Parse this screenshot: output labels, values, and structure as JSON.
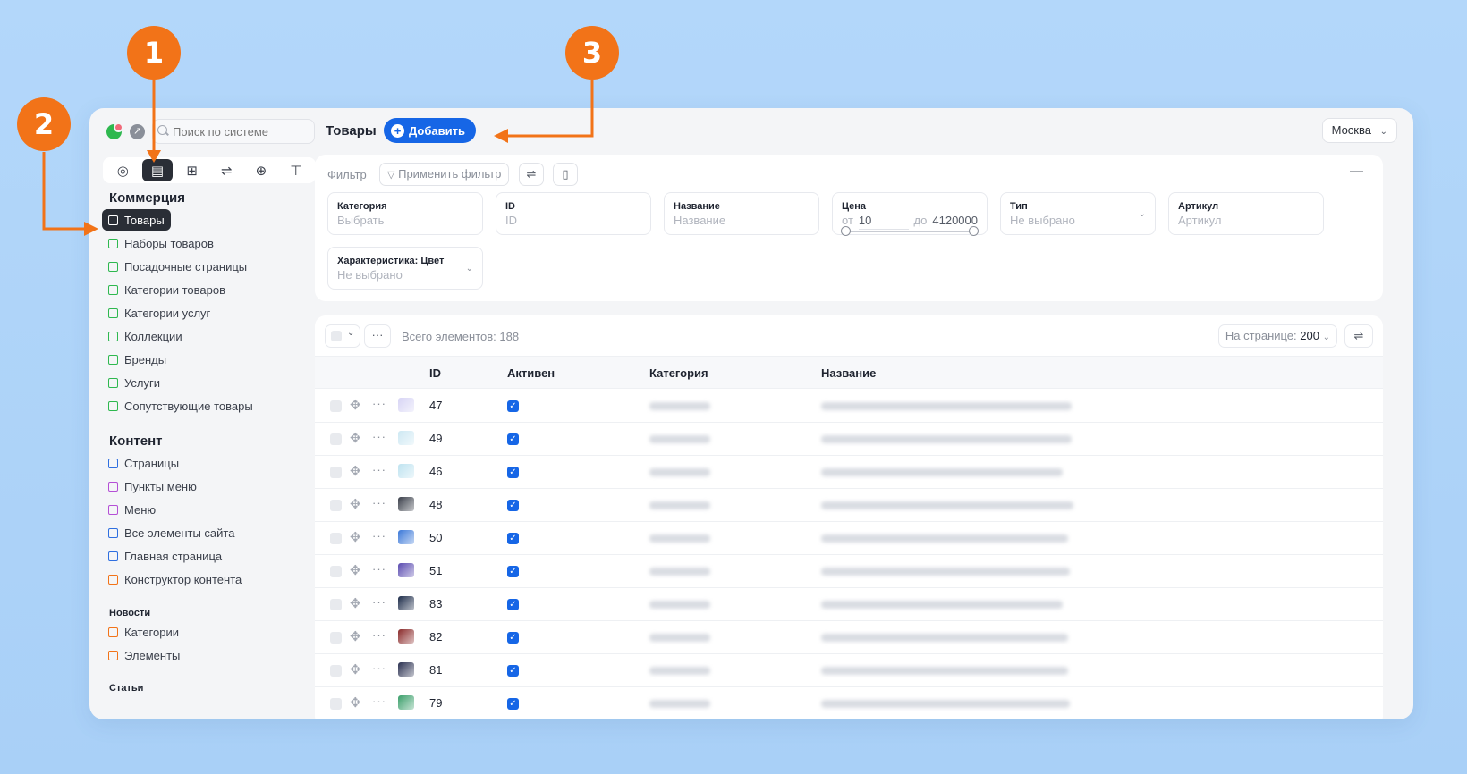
{
  "annotations": [
    "1",
    "2",
    "3"
  ],
  "search": {
    "placeholder": "Поиск по системе"
  },
  "sidebar": {
    "tab_icons": [
      "radar-icon",
      "products-icon",
      "book-icon",
      "sliders-icon",
      "plus-square-icon",
      "paint-roller-icon"
    ],
    "sections": {
      "commerce": "Коммерция",
      "content": "Контент",
      "news": "Новости",
      "articles": "Статьи"
    },
    "commerce_items": [
      {
        "label": "Товары",
        "color": "#ffffff",
        "active": true
      },
      {
        "label": "Наборы товаров",
        "color": "#2eb84f"
      },
      {
        "label": "Посадочные страницы",
        "color": "#2eb84f"
      },
      {
        "label": "Категории товаров",
        "color": "#2eb84f"
      },
      {
        "label": "Категории услуг",
        "color": "#2eb84f"
      },
      {
        "label": "Коллекции",
        "color": "#2eb84f"
      },
      {
        "label": "Бренды",
        "color": "#2eb84f"
      },
      {
        "label": "Услуги",
        "color": "#2eb84f"
      },
      {
        "label": "Сопутствующие товары",
        "color": "#2eb84f"
      }
    ],
    "content_items": [
      {
        "label": "Страницы",
        "color": "#2f6fe0"
      },
      {
        "label": "Пункты меню",
        "color": "#b44fd6"
      },
      {
        "label": "Меню",
        "color": "#b44fd6"
      },
      {
        "label": "Все элементы сайта",
        "color": "#2f6fe0"
      },
      {
        "label": "Главная страница",
        "color": "#2f6fe0"
      },
      {
        "label": "Конструктор контента",
        "color": "#f27318"
      }
    ],
    "news_items": [
      {
        "label": "Категории",
        "color": "#f27318"
      },
      {
        "label": "Элементы",
        "color": "#f27318"
      }
    ]
  },
  "header": {
    "title": "Товары",
    "add_label": "Добавить",
    "city": "Москва"
  },
  "filter": {
    "label": "Фильтр",
    "apply_label": "Применить фильтр",
    "collapse": "—",
    "fields": {
      "category": {
        "label": "Категория",
        "placeholder": "Выбрать"
      },
      "id": {
        "label": "ID",
        "placeholder": "ID"
      },
      "name": {
        "label": "Название",
        "placeholder": "Название"
      },
      "price": {
        "label": "Цена",
        "from_prefix": "от",
        "from_value": "10",
        "to_prefix": "до",
        "to_value": "4120000"
      },
      "type": {
        "label": "Тип",
        "placeholder": "Не выбрано"
      },
      "article": {
        "label": "Артикул",
        "placeholder": "Артикул"
      },
      "color": {
        "label": "Характеристика: Цвет",
        "placeholder": "Не выбрано"
      }
    }
  },
  "table": {
    "total": "Всего элементов: 188",
    "per_page_label": "На странице:",
    "per_page_value": "200",
    "columns": [
      "ID",
      "Активен",
      "Категория",
      "Название"
    ],
    "rows": [
      {
        "id": "47",
        "active": true,
        "thumb": "#d7d4f5"
      },
      {
        "id": "49",
        "active": true,
        "thumb": "#cde8f3"
      },
      {
        "id": "46",
        "active": true,
        "thumb": "#bfe3f0"
      },
      {
        "id": "48",
        "active": true,
        "thumb": "#3a3f4a"
      },
      {
        "id": "50",
        "active": true,
        "thumb": "#3b78d8"
      },
      {
        "id": "51",
        "active": true,
        "thumb": "#5a4bb0"
      },
      {
        "id": "83",
        "active": true,
        "thumb": "#1d2c4a"
      },
      {
        "id": "82",
        "active": true,
        "thumb": "#8a2a2a"
      },
      {
        "id": "81",
        "active": true,
        "thumb": "#2a3050"
      },
      {
        "id": "79",
        "active": true,
        "thumb": "#3a9f6a"
      }
    ]
  },
  "colors": {
    "accent": "#1666e6",
    "marker": "#f27318",
    "active_nav": "#2a2e36"
  }
}
